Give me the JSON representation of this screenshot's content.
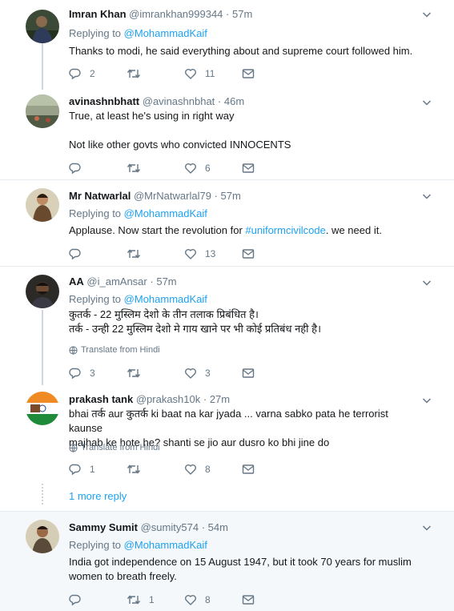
{
  "colors": {
    "accent": "#1da1f2",
    "muted": "#657786",
    "text": "#14171a",
    "border": "#e6ecf0",
    "shaded": "#f5f8fa"
  },
  "icons": {
    "reply": "reply-icon",
    "retweet": "retweet-icon",
    "like": "heart-icon",
    "dm": "envelope-icon",
    "caret": "chevron-down-icon",
    "translate": "globe-icon"
  },
  "tweets": [
    {
      "name": "Imran Khan",
      "handle": "@imrankhan999344",
      "dot": "·",
      "time": "57m",
      "replying_prefix": "Replying to",
      "replying_to": "@MohammadKaif",
      "text": "Thanks to modi, he said everything about and supreme court followed him.",
      "reply_count": "2",
      "retweet_count": "",
      "like_count": "11"
    },
    {
      "name": "avinashnbhatt",
      "handle": "@avinashnbhat",
      "dot": "·",
      "time": "46m",
      "line1": "True, at least he's using in right way",
      "line2": "Not like other govts who convicted INNOCENTS",
      "reply_count": "",
      "retweet_count": "",
      "like_count": "6"
    },
    {
      "name": "Mr Natwarlal",
      "handle": "@MrNatwarlal79",
      "dot": "·",
      "time": "57m",
      "replying_prefix": "Replying to",
      "replying_to": "@MohammadKaif",
      "text_before": "Applause. Now start the revolution for ",
      "hashtag": "#uniformcivilcode",
      "text_after": ". we need it.",
      "reply_count": "",
      "retweet_count": "",
      "like_count": "13"
    },
    {
      "name": "AA",
      "handle": "@i_amAnsar",
      "dot": "·",
      "time": "57m",
      "replying_prefix": "Replying to",
      "replying_to": "@MohammadKaif",
      "line1": "कुतर्क - 22 मुस्लिम देशो के तीन तलाक प्रिबंधित है।",
      "line2": "तर्क - उन्ही 22 मुस्लिम देशो मे गाय खाने पर भी कोई प्रतिबंध नही है।",
      "translate": "Translate from Hindi",
      "reply_count": "3",
      "retweet_count": "",
      "like_count": "3"
    },
    {
      "name": "prakash tank",
      "handle": "@prakash10k",
      "dot": "·",
      "time": "27m",
      "line1": "bhai तर्क aur कुतर्क ki baat na kar jyada ... varna sabko pata he terrorist kaunse",
      "line2": "majhab ke hote he? shanti se jio aur dusro ko bhi jine do",
      "translate": "Translate from Hindi",
      "reply_count": "1",
      "retweet_count": "",
      "like_count": "8"
    },
    {
      "name": "Sammy Sumit",
      "handle": "@sumity574",
      "dot": "·",
      "time": "54m",
      "replying_prefix": "Replying to",
      "replying_to": "@MohammadKaif",
      "line1": "India got independence on 15 August 1947, but  it took 70 years for muslim",
      "line2": "women to breath freely.",
      "reply_count": "",
      "retweet_count": "1",
      "like_count": "8"
    }
  ],
  "more_reply": "1 more reply"
}
